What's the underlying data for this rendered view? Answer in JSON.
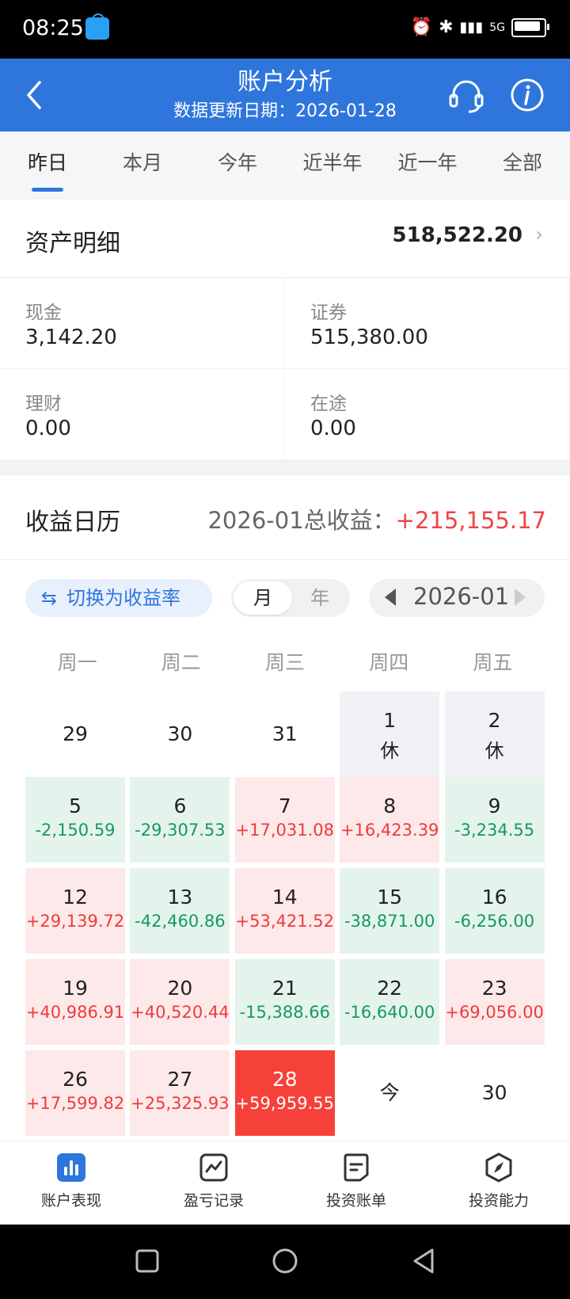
{
  "status_bar": {
    "time": "08:25",
    "network": "5G"
  },
  "header": {
    "title": "账户分析",
    "subtitle": "数据更新日期：2026-01-28"
  },
  "tabs": [
    "昨日",
    "本月",
    "今年",
    "近半年",
    "近一年",
    "全部"
  ],
  "active_tab": "昨日",
  "assets": {
    "label": "资产明细",
    "total": "518,522.20",
    "items": [
      {
        "label": "现金",
        "value": "3,142.20"
      },
      {
        "label": "证券",
        "value": "515,380.00"
      },
      {
        "label": "理财",
        "value": "0.00"
      },
      {
        "label": "在途",
        "value": "0.00"
      }
    ]
  },
  "calendar": {
    "label": "收益日历",
    "summary_prefix": "2026-01总收益：",
    "summary_value": "+215,155.17",
    "switch_label": "切换为收益率",
    "switch_icon": "swap-icon",
    "seg_month": "月",
    "seg_year": "年",
    "month": "2026-01",
    "weekdays": [
      "周一",
      "周二",
      "周三",
      "周四",
      "周五"
    ],
    "weeks": [
      [
        {
          "d": "29",
          "p": "",
          "t": "plain"
        },
        {
          "d": "30",
          "p": "",
          "t": "plain"
        },
        {
          "d": "31",
          "p": "",
          "t": "plain"
        },
        {
          "d": "1",
          "p": "休",
          "t": "hol"
        },
        {
          "d": "2",
          "p": "休",
          "t": "hol"
        }
      ],
      [
        {
          "d": "5",
          "p": "-2,150.59",
          "t": "neg"
        },
        {
          "d": "6",
          "p": "-29,307.53",
          "t": "neg"
        },
        {
          "d": "7",
          "p": "+17,031.08",
          "t": "pos"
        },
        {
          "d": "8",
          "p": "+16,423.39",
          "t": "pos"
        },
        {
          "d": "9",
          "p": "-3,234.55",
          "t": "neg"
        }
      ],
      [
        {
          "d": "12",
          "p": "+29,139.72",
          "t": "pos"
        },
        {
          "d": "13",
          "p": "-42,460.86",
          "t": "neg"
        },
        {
          "d": "14",
          "p": "+53,421.52",
          "t": "pos"
        },
        {
          "d": "15",
          "p": "-38,871.00",
          "t": "neg"
        },
        {
          "d": "16",
          "p": "-6,256.00",
          "t": "neg"
        }
      ],
      [
        {
          "d": "19",
          "p": "+40,986.91",
          "t": "pos"
        },
        {
          "d": "20",
          "p": "+40,520.44",
          "t": "pos"
        },
        {
          "d": "21",
          "p": "-15,388.66",
          "t": "neg"
        },
        {
          "d": "22",
          "p": "-16,640.00",
          "t": "neg"
        },
        {
          "d": "23",
          "p": "+69,056.00",
          "t": "pos"
        }
      ],
      [
        {
          "d": "26",
          "p": "+17,599.82",
          "t": "pos"
        },
        {
          "d": "27",
          "p": "+25,325.93",
          "t": "pos"
        },
        {
          "d": "28",
          "p": "+59,959.55",
          "t": "today"
        },
        {
          "d": "今",
          "p": "",
          "t": "plain"
        },
        {
          "d": "30",
          "p": "",
          "t": "plain"
        }
      ]
    ]
  },
  "bottom_nav": [
    {
      "label": "账户表现",
      "icon": "bar-chart-icon",
      "active": true
    },
    {
      "label": "盈亏记录",
      "icon": "line-chart-icon",
      "active": false
    },
    {
      "label": "投资账单",
      "icon": "bill-icon",
      "active": false
    },
    {
      "label": "投资能力",
      "icon": "compass-icon",
      "active": false
    }
  ],
  "colors": {
    "brand": "#2f76dc",
    "gain": "#ee3b3b",
    "loss": "#169a5a",
    "today": "#f5413a"
  }
}
